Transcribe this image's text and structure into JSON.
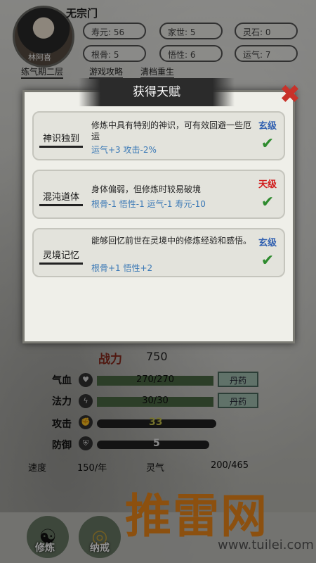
{
  "header": {
    "sect": "无宗门",
    "name": "林阿喜",
    "realm": "练气期二层",
    "stats": [
      {
        "label": "寿元",
        "value": "56"
      },
      {
        "label": "家世",
        "value": "5"
      },
      {
        "label": "灵石",
        "value": "0"
      },
      {
        "label": "根骨",
        "value": "5"
      },
      {
        "label": "悟性",
        "value": "6"
      },
      {
        "label": "运气",
        "value": "7"
      }
    ],
    "links": [
      "游戏攻略",
      "清档重生"
    ]
  },
  "dialog": {
    "title": "获得天赋",
    "talents": [
      {
        "name": "神识独到",
        "desc": "修炼中具有特别的神识，可有效回避一些厄运",
        "effects": "运气+3  攻击-2%",
        "grade": "玄级",
        "grade_color": "#2f5fb0"
      },
      {
        "name": "混沌道体",
        "desc": "身体偏弱，但修炼时较易破境",
        "effects": "根骨-1  悟性-1  运气-1  寿元-10",
        "grade": "天级",
        "grade_color": "#d11c1c"
      },
      {
        "name": "灵境记忆",
        "desc": "能够回忆前世在灵境中的修炼经验和感悟。",
        "effects": "根骨+1  悟性+2",
        "grade": "玄级",
        "grade_color": "#2f5fb0"
      }
    ]
  },
  "stats": {
    "power_label": "战力",
    "power_value": "750",
    "hp_label": "气血",
    "hp_text": "270/270",
    "hp_fraction": 1.0,
    "mp_label": "法力",
    "mp_text": "30/30",
    "mp_fraction": 1.0,
    "pill_label": "丹药",
    "atk_label": "攻击",
    "atk_value": "33",
    "def_label": "防御",
    "def_value": "5",
    "speed_label": "速度",
    "speed_value": "150/年",
    "qi_label": "灵气",
    "qi_value": "200/465"
  },
  "nav": {
    "items": [
      "修炼",
      "纳戒"
    ]
  },
  "watermark": {
    "text": "推雷网",
    "url": "www.tuilei.com"
  }
}
